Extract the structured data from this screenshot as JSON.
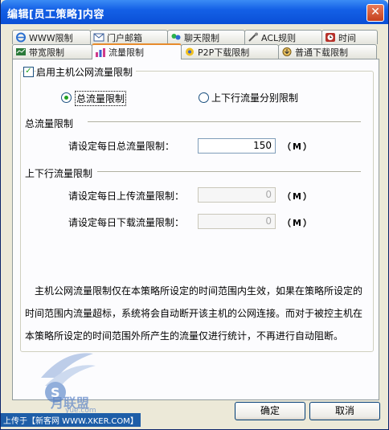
{
  "window": {
    "title": "编辑[员工策略]内容",
    "close_label": "✕"
  },
  "tabs_row1": [
    {
      "label": "WWW限制",
      "icon": "ie-icon"
    },
    {
      "label": "门户邮箱",
      "icon": "mail-icon"
    },
    {
      "label": "聊天限制",
      "icon": "chat-icon"
    },
    {
      "label": "ACL规则",
      "icon": "acl-icon"
    },
    {
      "label": "时间",
      "icon": "clock-icon"
    }
  ],
  "tabs_row2": [
    {
      "label": "带宽限制",
      "icon": "bandwidth-icon"
    },
    {
      "label": "流量限制",
      "icon": "traffic-icon",
      "active": true
    },
    {
      "label": "P2P下载限制",
      "icon": "p2p-icon"
    },
    {
      "label": "普通下载限制",
      "icon": "download-icon"
    }
  ],
  "enable": {
    "label": "启用主机公网流量限制",
    "checked": true,
    "mark": "✓"
  },
  "mode": {
    "total_label": "总流量限制",
    "updown_label": "上下行流量分别限制",
    "selected": "total"
  },
  "total_section": {
    "title": "总流量限制",
    "daily_label": "请设定每日总流量限制：",
    "daily_value": "150",
    "unit": "（M）"
  },
  "updown_section": {
    "title": "上下行流量限制",
    "upload_label": "请设定每日上传流量限制：",
    "upload_value": "0",
    "download_label": "请设定每日下载流量限制：",
    "download_value": "0",
    "unit": "（M）"
  },
  "description": "主机公网流量限制仅在本策略所设定的时间范围内生效，如果在策略所设定的时间范围内流量超标，系统将会自动断开该主机的公网连接。而对于被控主机在本策略所设定的时间范围外所产生的流量仅进行统计，不再进行自动阻断。",
  "buttons": {
    "ok": "确定",
    "cancel": "取消"
  },
  "footer": "上传于【新客网 WWW.XKER.COM】",
  "watermark": {
    "text": "月联盟",
    "sub": "yue.com"
  },
  "colors": {
    "title_bar": "#0a4fd6",
    "active_tab_accent": "#e68b2c",
    "check": "#21a121"
  }
}
